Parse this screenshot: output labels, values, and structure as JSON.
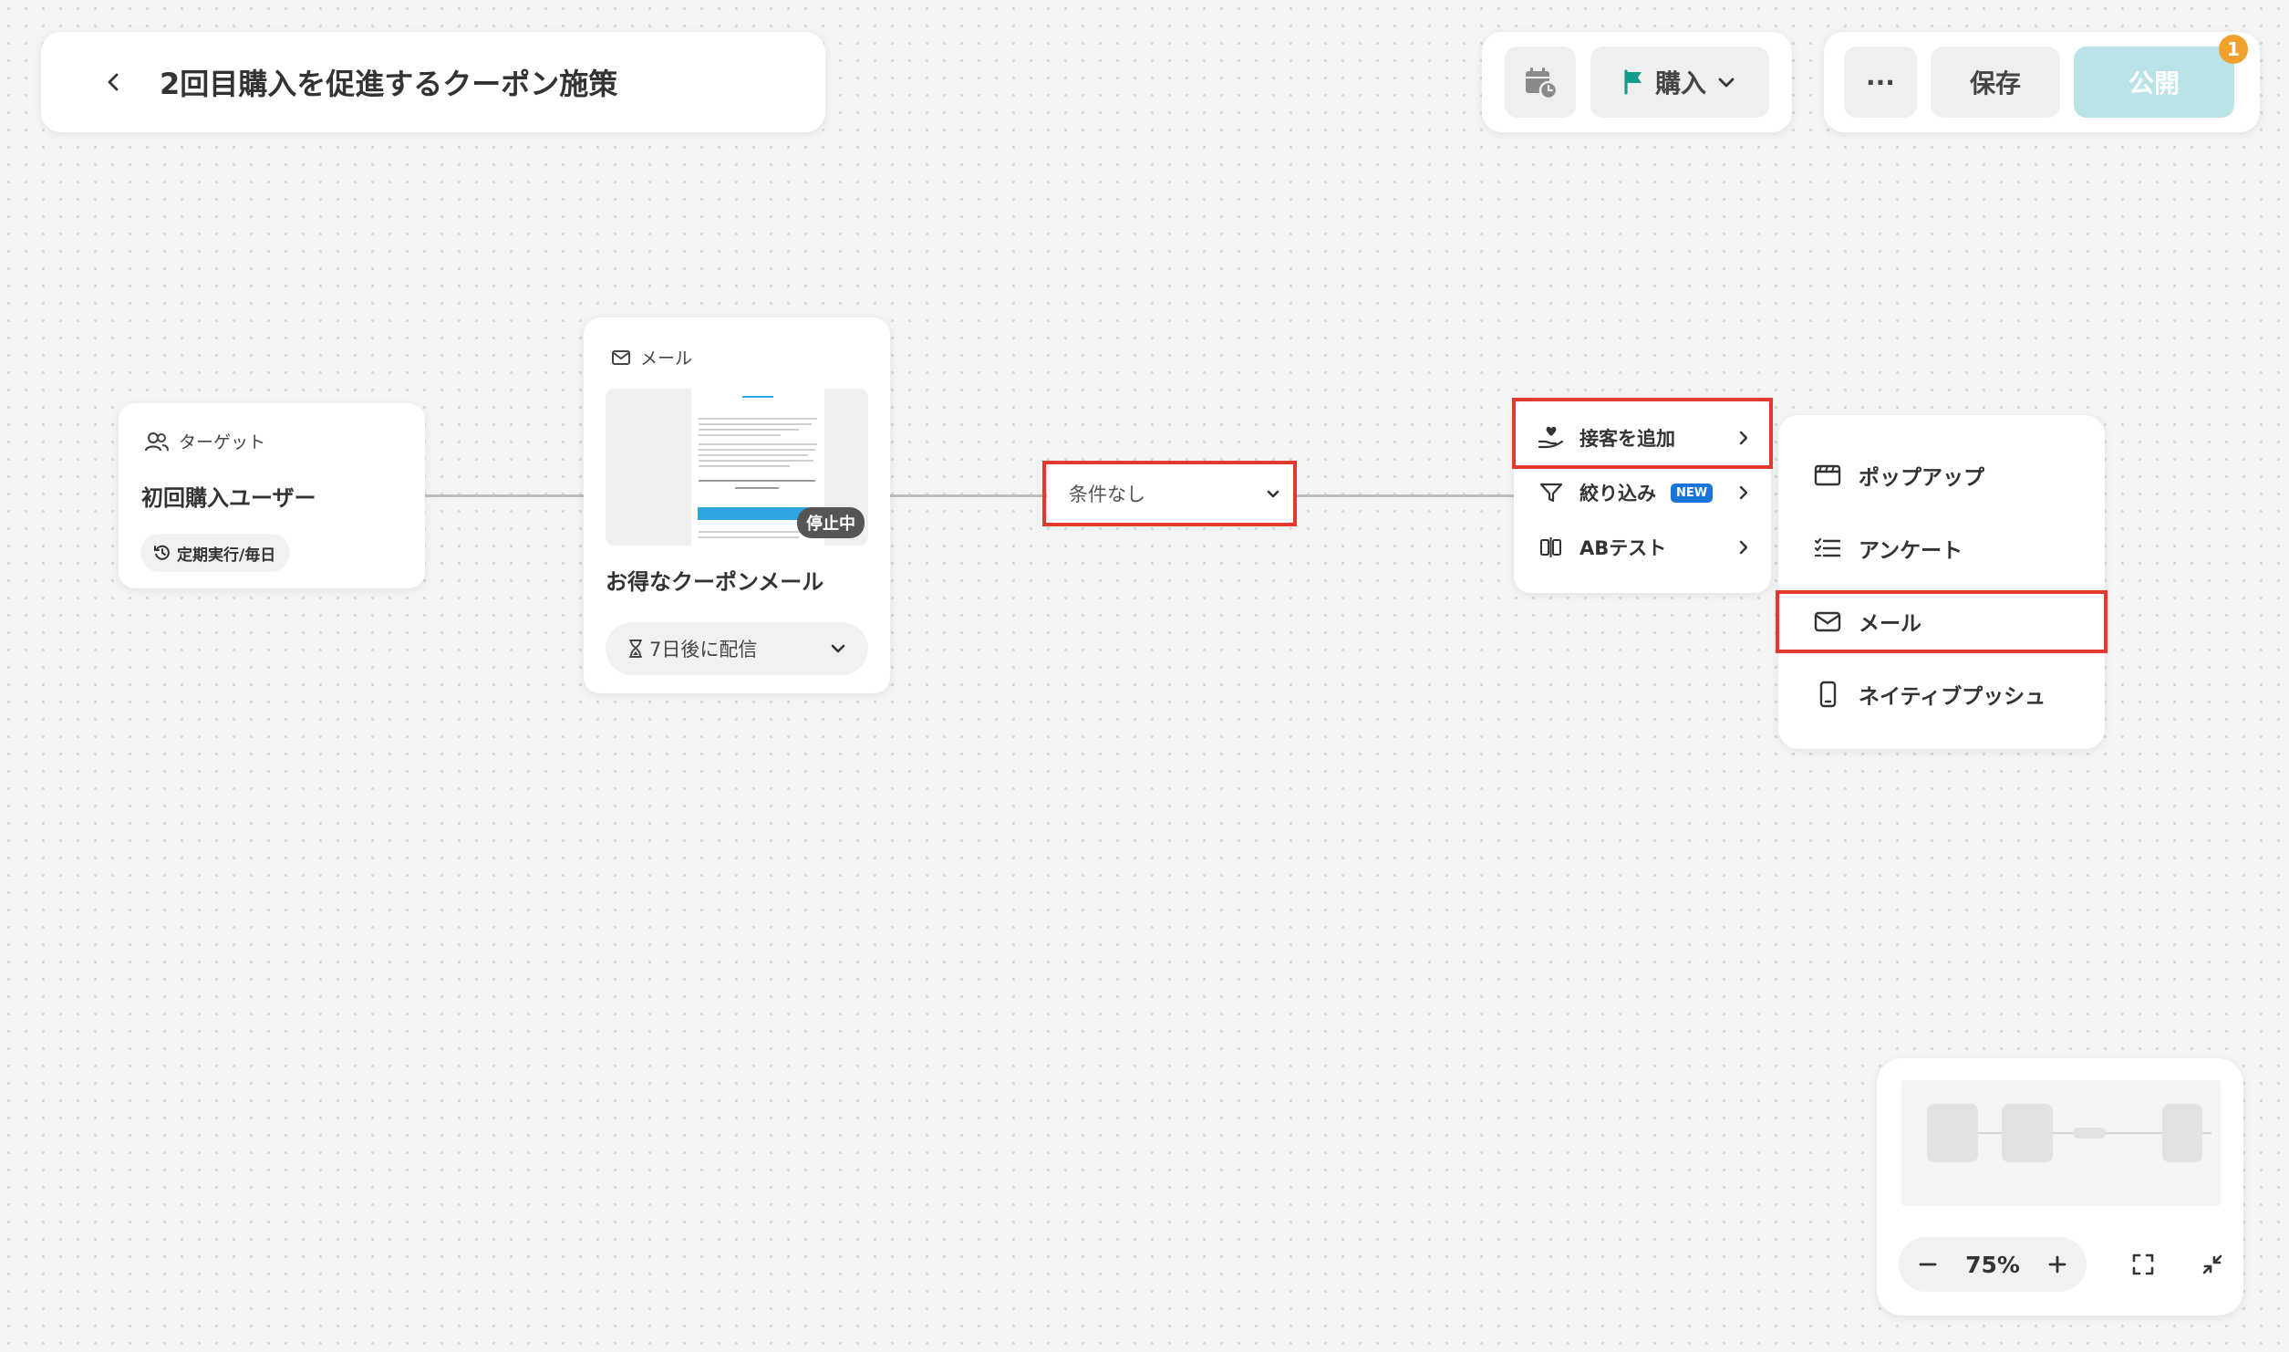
{
  "header": {
    "title": "2回目購入を促進するクーポン施策",
    "goal_label": "購入",
    "more_label": "···",
    "save_label": "保存",
    "publish_label": "公開",
    "notification_count": "1"
  },
  "target_node": {
    "type_label": "ターゲット",
    "name": "初回購入ユーザー",
    "schedule": "定期実行/毎日"
  },
  "email_node": {
    "type_label": "メール",
    "name": "お得なクーポンメール",
    "status": "停止中",
    "delay": "7日後に配信"
  },
  "condition": {
    "value": "条件なし"
  },
  "add_menu": {
    "items": [
      {
        "label": "接客を追加",
        "icon": "hand-heart-icon"
      },
      {
        "label": "絞り込み",
        "icon": "filter-icon",
        "badge": "NEW"
      },
      {
        "label": "ABテスト",
        "icon": "ab-test-icon"
      }
    ]
  },
  "channel_menu": {
    "items": [
      {
        "label": "ポップアップ",
        "icon": "popup-icon"
      },
      {
        "label": "アンケート",
        "icon": "survey-icon"
      },
      {
        "label": "メール",
        "icon": "mail-icon"
      },
      {
        "label": "ネイティブプッシュ",
        "icon": "mobile-icon"
      }
    ]
  },
  "zoom": {
    "level": "75%"
  },
  "colors": {
    "highlight": "#e23b2e",
    "goal_flag": "#139c8e",
    "publish": "#b9e3e7",
    "badge": "#f0a12c",
    "new_badge": "#1b74d8"
  }
}
